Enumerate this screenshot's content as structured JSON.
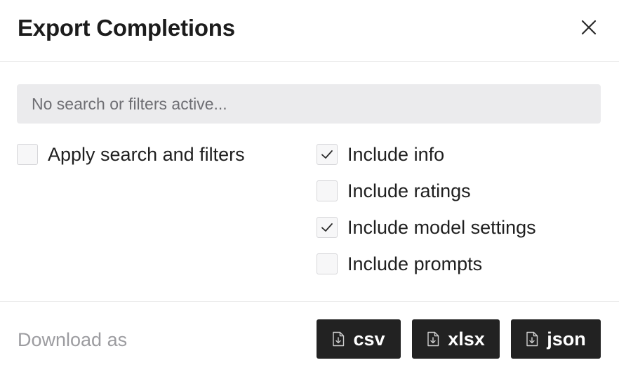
{
  "dialog": {
    "title": "Export Completions",
    "close_icon": "close-icon"
  },
  "filter": {
    "status_text": "No search or filters active..."
  },
  "options": {
    "apply_search": {
      "label": "Apply search and filters",
      "checked": false
    },
    "include_info": {
      "label": "Include info",
      "checked": true
    },
    "include_ratings": {
      "label": "Include ratings",
      "checked": false
    },
    "include_model_settings": {
      "label": "Include model settings",
      "checked": true
    },
    "include_prompts": {
      "label": "Include prompts",
      "checked": false
    }
  },
  "footer": {
    "download_label": "Download as",
    "buttons": [
      {
        "label": "csv",
        "icon": "file-download-icon"
      },
      {
        "label": "xlsx",
        "icon": "file-download-icon"
      },
      {
        "label": "json",
        "icon": "file-download-icon"
      }
    ]
  },
  "colors": {
    "button_bg": "#222222",
    "filter_bg": "#ebebed",
    "muted_text": "#9c9ca0"
  }
}
